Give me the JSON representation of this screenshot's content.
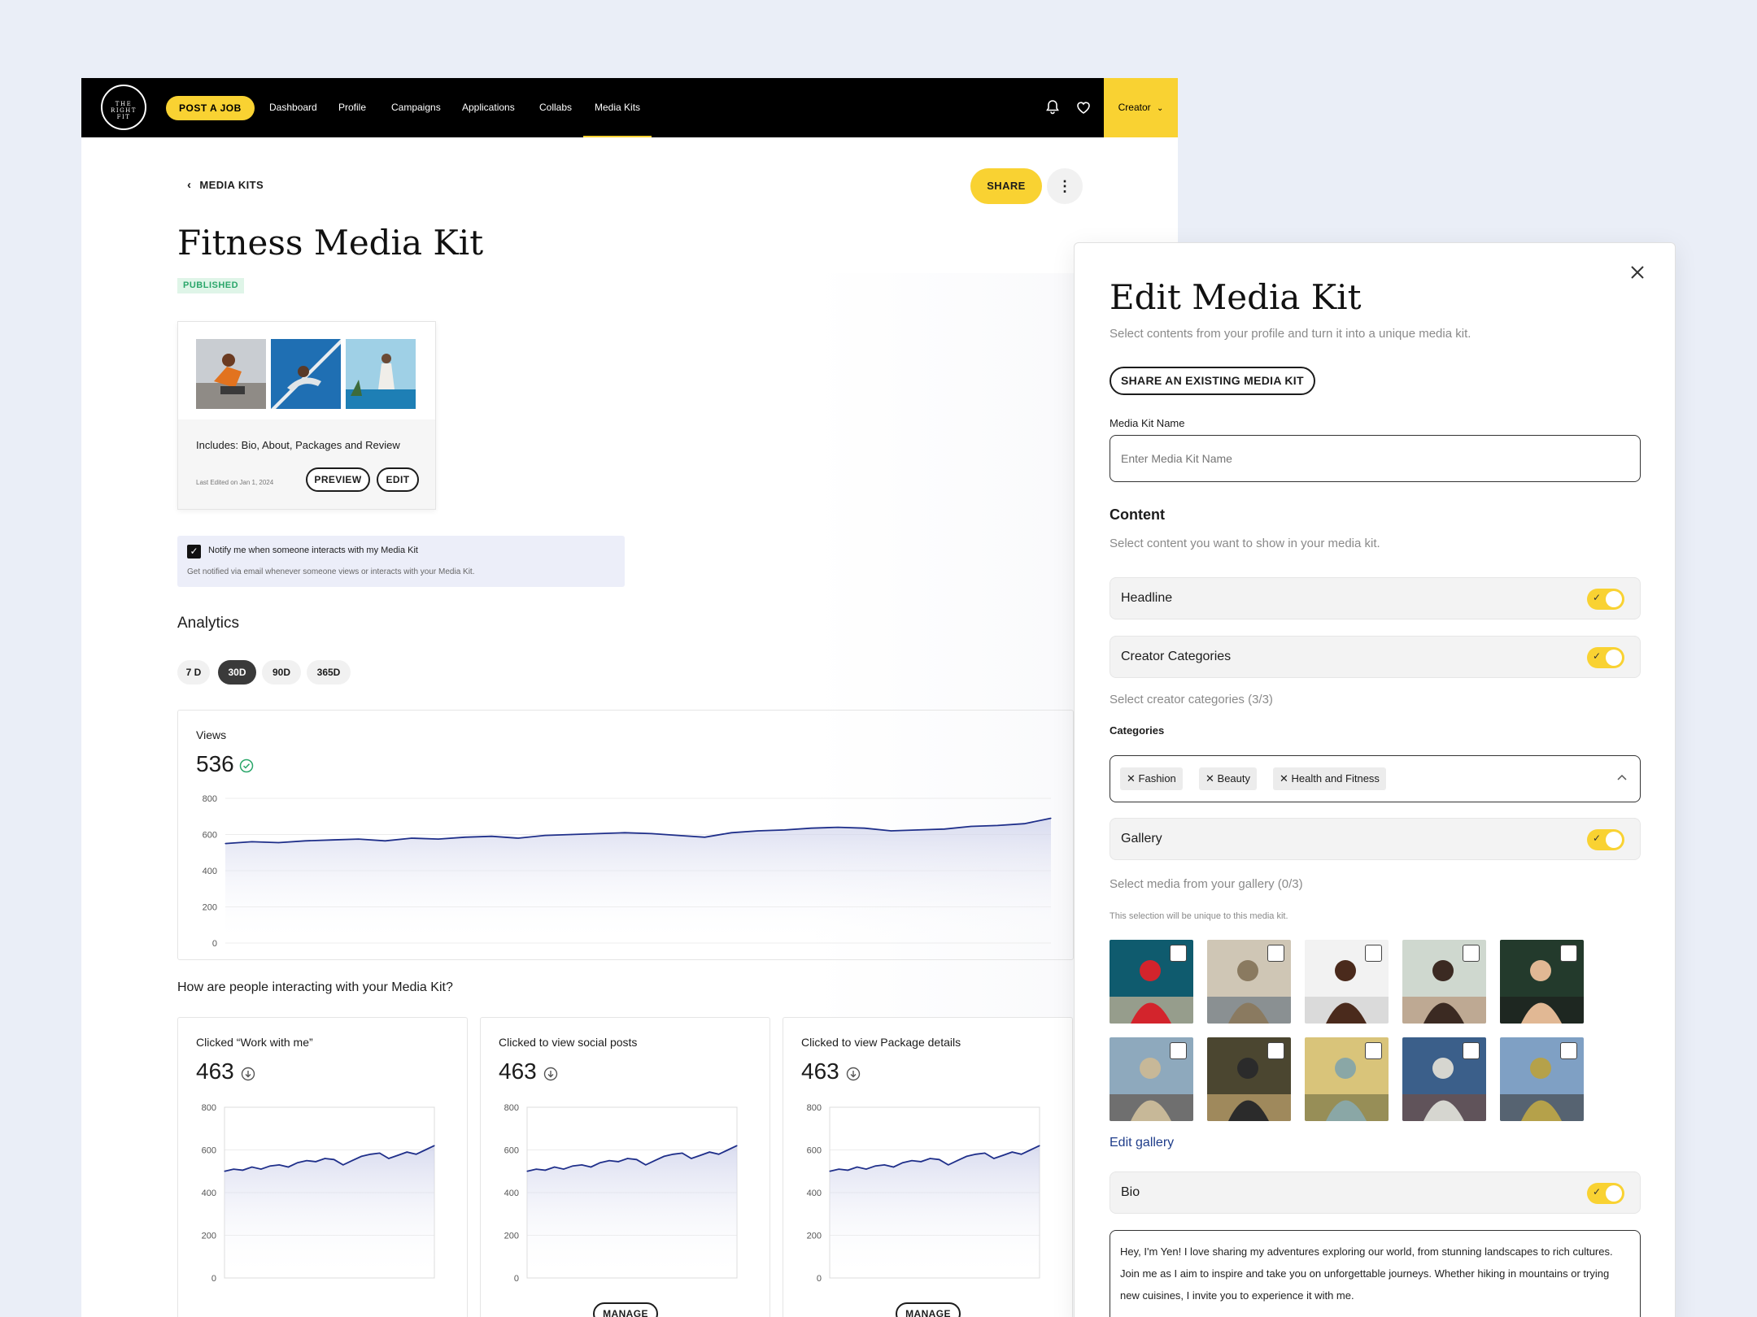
{
  "nav": {
    "logo_text": "THE RIGHT FIT",
    "post_job": "POST A JOB",
    "items": [
      "Dashboard",
      "Profile",
      "Campaigns",
      "Applications",
      "Collabs",
      "Media Kits"
    ],
    "active": "Media Kits",
    "account": "Creator",
    "icons": [
      "bell-icon",
      "heart-icon",
      "chevron-down-icon"
    ]
  },
  "header": {
    "back_label": "MEDIA KITS",
    "share_label": "SHARE",
    "more_label": "⋮"
  },
  "kit": {
    "title": "Fitness Media Kit",
    "status": "PUBLISHED",
    "includes": "Includes: Bio, About, Packages and Review",
    "last_edited": "Last Edited on Jan 1, 2024",
    "preview_label": "PREVIEW",
    "edit_label": "EDIT"
  },
  "notify": {
    "checked": true,
    "title": "Notify me when someone interacts with my Media Kit",
    "subtitle": "Get notified via email whenever someone views or interacts with your Media Kit."
  },
  "analytics": {
    "heading": "Analytics",
    "ranges": [
      "7 D",
      "30D",
      "90D",
      "365D"
    ],
    "selected_range": "30D",
    "views": {
      "label": "Views",
      "value": "536",
      "icon": "check-circle-icon"
    },
    "interact_heading": "How are people interacting with your Media Kit?",
    "cards": [
      {
        "label": "Clicked “Work with me”",
        "value": "463",
        "icon": "arrow-down-circle-icon",
        "button": ""
      },
      {
        "label": "Clicked to view social posts",
        "value": "463",
        "icon": "arrow-down-circle-icon",
        "button": "MANAGE"
      },
      {
        "label": "Clicked to view Package details",
        "value": "463",
        "icon": "arrow-down-circle-icon",
        "button": "MANAGE"
      }
    ]
  },
  "chart_data": [
    {
      "type": "area",
      "title": "Views",
      "ylim": [
        0,
        800
      ],
      "yticks": [
        "800",
        "600",
        "400",
        "200",
        "0"
      ],
      "grid": true,
      "series": [
        {
          "values": [
            550,
            560,
            555,
            565,
            570,
            575,
            565,
            580,
            575,
            585,
            590,
            580,
            595,
            600,
            605,
            610,
            605,
            595,
            585,
            610,
            620,
            625,
            635,
            640,
            635,
            620,
            625,
            630,
            645,
            650,
            660,
            690
          ]
        }
      ]
    },
    {
      "type": "area",
      "title": "Clicked “Work with me”",
      "ylim": [
        0,
        800
      ],
      "yticks": [
        "800",
        "600",
        "400",
        "200",
        "0"
      ],
      "grid": true,
      "series": [
        {
          "values": [
            500,
            510,
            505,
            520,
            510,
            525,
            530,
            520,
            540,
            550,
            545,
            560,
            555,
            530,
            550,
            570,
            580,
            585,
            560,
            575,
            590,
            580,
            600,
            620
          ]
        }
      ]
    },
    {
      "type": "area",
      "title": "Clicked to view social posts",
      "ylim": [
        0,
        800
      ],
      "yticks": [
        "800",
        "600",
        "400",
        "200",
        "0"
      ],
      "grid": true,
      "series": [
        {
          "values": [
            500,
            510,
            505,
            520,
            510,
            525,
            530,
            520,
            540,
            550,
            545,
            560,
            555,
            530,
            550,
            570,
            580,
            585,
            560,
            575,
            590,
            580,
            600,
            620
          ]
        }
      ]
    },
    {
      "type": "area",
      "title": "Clicked to view Package details",
      "ylim": [
        0,
        800
      ],
      "yticks": [
        "800",
        "600",
        "400",
        "200",
        "0"
      ],
      "grid": true,
      "series": [
        {
          "values": [
            500,
            510,
            505,
            520,
            510,
            525,
            530,
            520,
            540,
            550,
            545,
            560,
            555,
            530,
            550,
            570,
            580,
            585,
            560,
            575,
            590,
            580,
            600,
            620
          ]
        }
      ]
    }
  ],
  "panel": {
    "title": "Edit Media Kit",
    "subtitle": "Select contents from your profile and turn it into a unique media kit.",
    "share_existing": "SHARE AN EXISTING MEDIA KIT",
    "name_label": "Media Kit Name",
    "name_placeholder": "Enter Media Kit Name",
    "content_heading": "Content",
    "content_sub": "Select content you want to show in your media kit.",
    "toggles": [
      {
        "label": "Headline",
        "on": true
      },
      {
        "label": "Creator Categories",
        "on": true
      },
      {
        "label": "Gallery",
        "on": true
      },
      {
        "label": "Bio",
        "on": true
      }
    ],
    "categories_hint": "Select creator categories (3/3)",
    "categories_label": "Categories",
    "categories": [
      "Fashion",
      "Beauty",
      "Health and Fitness"
    ],
    "gallery_hint": "Select media from your gallery (0/3)",
    "gallery_note": "This selection will be unique to this media kit.",
    "gallery_count": 10,
    "edit_gallery": "Edit gallery",
    "bio_text": "Hey, I'm Yen! I love sharing my adventures exploring our world, from stunning landscapes to rich cultures. Join me as I aim to inspire and take you on unforgettable journeys. Whether hiking in mountains or trying new cuisines, I invite you to experience it with me.",
    "colors": {
      "accent": "#f9d232",
      "success": "#2aa66a",
      "line": "#1f2f8a",
      "link": "#1f3d8a"
    }
  }
}
